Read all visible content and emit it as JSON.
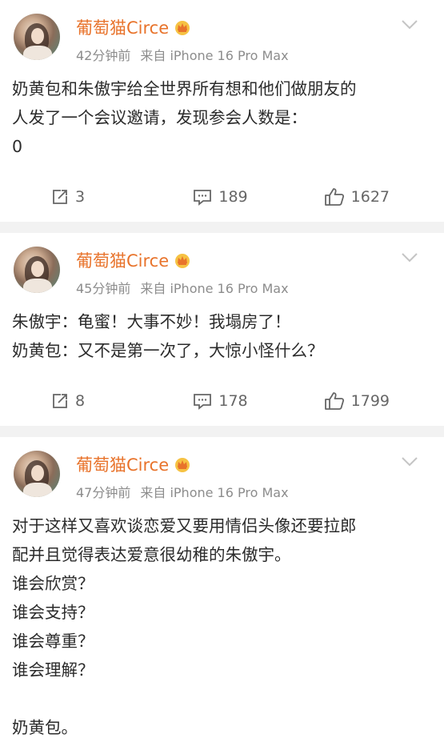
{
  "posts": [
    {
      "author": "葡萄猫Circe",
      "time": "42分钟前",
      "source": "来自 iPhone 16 Pro Max",
      "lines": [
        "奶黄包和朱傲宇给全世界所有想和他们做朋友的",
        "人发了一个会议邀请，发现参会人数是：",
        "0"
      ],
      "reposts": "3",
      "comments": "189",
      "likes": "1627"
    },
    {
      "author": "葡萄猫Circe",
      "time": "45分钟前",
      "source": "来自 iPhone 16 Pro Max",
      "lines": [
        "朱傲宇：龟蜜！大事不妙！我塌房了！",
        "奶黄包：又不是第一次了，大惊小怪什么？"
      ],
      "reposts": "8",
      "comments": "178",
      "likes": "1799"
    },
    {
      "author": "葡萄猫Circe",
      "time": "47分钟前",
      "source": "来自 iPhone 16 Pro Max",
      "lines": [
        "对于这样又喜欢谈恋爱又要用情侣头像还要拉郎",
        "配并且觉得表达爱意很幼稚的朱傲宇。",
        "谁会欣赏？",
        "谁会支持？",
        "谁会尊重？",
        "谁会理解？",
        "",
        "奶黄包。"
      ]
    }
  ],
  "icons": {
    "crown": "crown-badge-icon",
    "menu": "chevron-down-icon",
    "repost": "repost-icon",
    "comment": "comment-icon",
    "like": "thumbs-up-icon"
  },
  "colors": {
    "author": "#e8732b",
    "meta": "#8c8c8c",
    "text": "#2b2b2b",
    "separator": "#f2f2f2"
  }
}
